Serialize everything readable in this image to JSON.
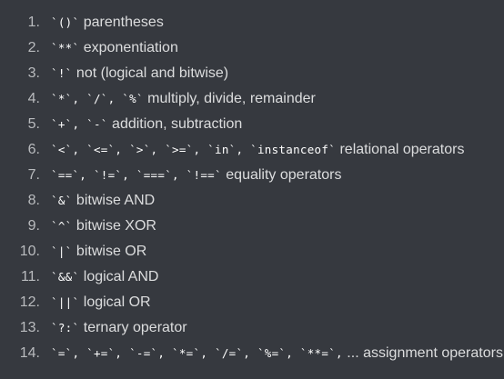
{
  "list": {
    "items": [
      {
        "number": "1.",
        "code": "`()`",
        "desc": " parentheses"
      },
      {
        "number": "2.",
        "code": "`**`",
        "desc": " exponentiation"
      },
      {
        "number": "3.",
        "code": "`!`",
        "desc": " not (logical and bitwise)"
      },
      {
        "number": "4.",
        "code": "`*`, `/`, `%`",
        "desc": " multiply, divide, remainder"
      },
      {
        "number": "5.",
        "code": "`+`, `-`",
        "desc": " addition, subtraction"
      },
      {
        "number": "6.",
        "code": "`<`, `<=`, `>`, `>=`, `in`, `instanceof`",
        "desc": " relational operators"
      },
      {
        "number": "7.",
        "code": "`==`, `!=`, `===`, `!==`",
        "desc": " equality operators"
      },
      {
        "number": "8.",
        "code": "`&`",
        "desc": " bitwise AND"
      },
      {
        "number": "9.",
        "code": "`^`",
        "desc": " bitwise XOR"
      },
      {
        "number": "10.",
        "code": "`|`",
        "desc": " bitwise OR"
      },
      {
        "number": "11.",
        "code": "`&&`",
        "desc": " logical AND"
      },
      {
        "number": "12.",
        "code": "`||`",
        "desc": " logical OR"
      },
      {
        "number": "13.",
        "code": "`?:`",
        "desc": " ternary operator"
      },
      {
        "number": "14.",
        "code": "`=`, `+=`, `-=`, `*=`, `/=`, `%=`, `**=`,",
        "desc": " ... assignment operators"
      }
    ]
  }
}
